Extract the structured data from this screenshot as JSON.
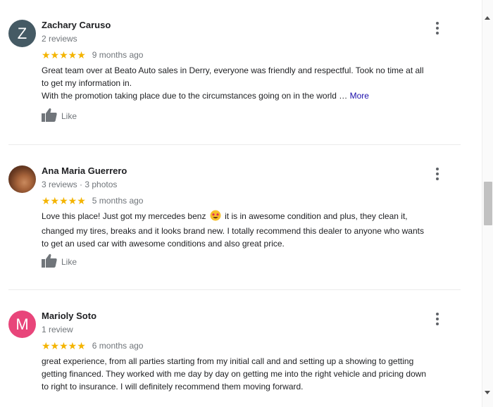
{
  "colors": {
    "star": "#f4b400",
    "link": "#1a0dab",
    "avatar_z": "#455a64",
    "avatar_m": "#e8457a"
  },
  "reviews": [
    {
      "avatar_letter": "Z",
      "name": "Zachary Caruso",
      "sub": "2 reviews",
      "stars": "★★★★★",
      "time": "9 months ago",
      "text_lines": [
        "Great team over at Beato Auto sales in Derry,  everyone was friendly and respectful. Took no time at all",
        "to get my information in.",
        "With the promotion taking place due to the circumstances going on in the world … "
      ],
      "more": "More",
      "like": "Like"
    },
    {
      "avatar_letter": "",
      "name": "Ana Maria Guerrero",
      "sub": "3 reviews · 3 photos",
      "stars": "★★★★★",
      "time": "5 months ago",
      "text_before_emoji": "Love this place! Just got my mercedes benz",
      "text_after_emoji": "it is in awesome condition and plus, they clean it,",
      "text_lines": [
        "changed my tires, breaks and it looks brand new. I totally recommend this dealer to anyone who wants",
        "to get an used car with awesome conditions and also great price."
      ],
      "like": "Like"
    },
    {
      "avatar_letter": "M",
      "name": "Marioly Soto",
      "sub": "1 review",
      "stars": "★★★★★",
      "time": "6 months ago",
      "text_lines": [
        "great experience, from all parties starting from my initial call and and setting up a showing to getting",
        "getting financed. They worked with me day by day on getting me into the right vehicle and pricing down",
        "to right to insurance. I will definitely recommend them moving forward."
      ]
    }
  ]
}
